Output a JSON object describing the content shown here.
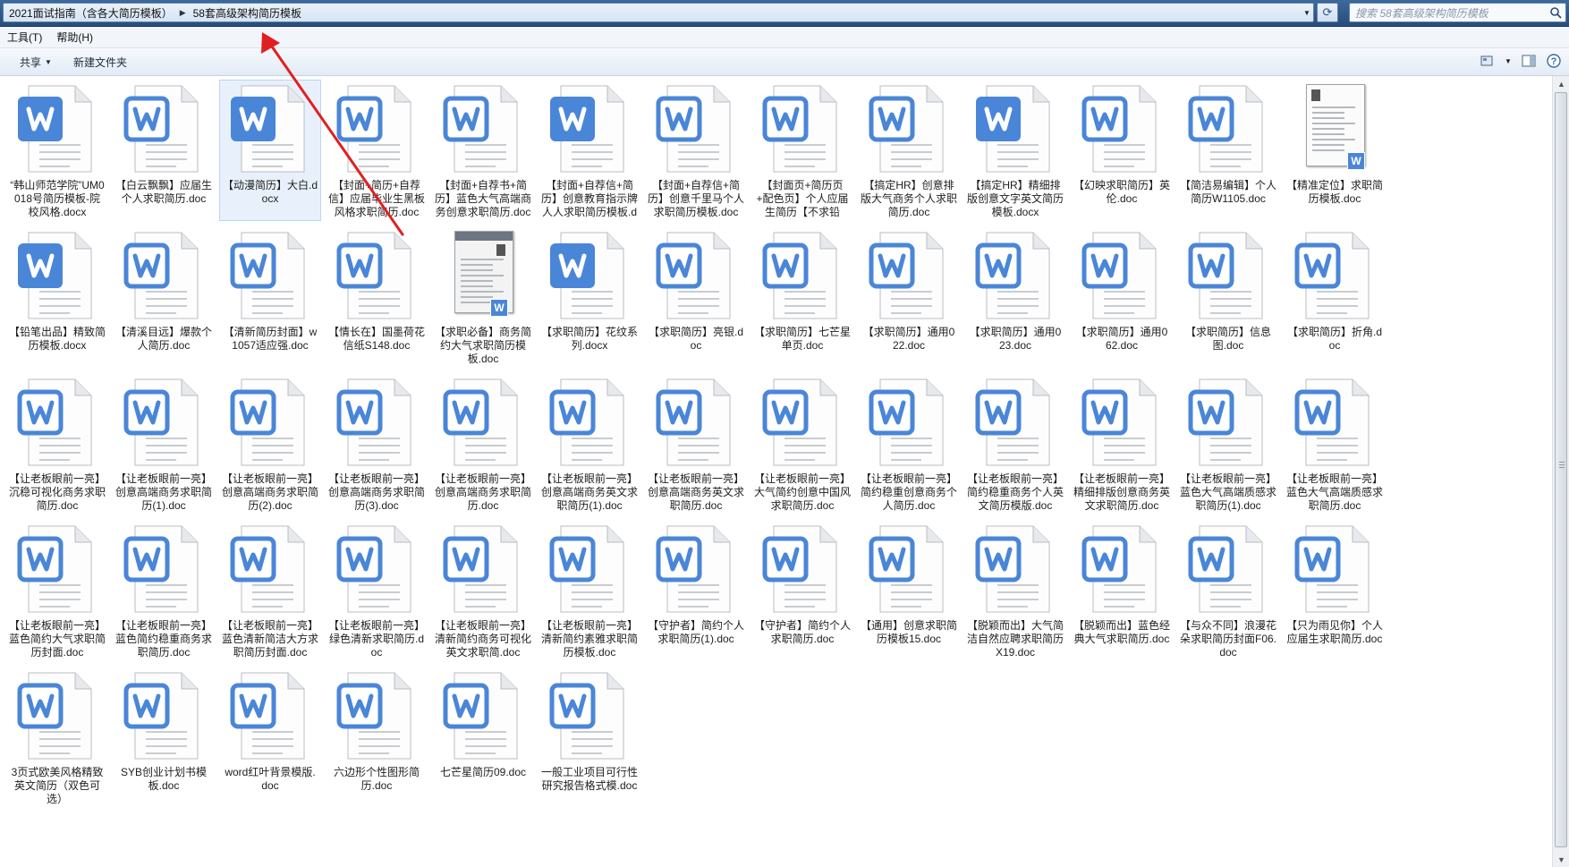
{
  "address_bar": {
    "crumbs": [
      "2021面试指南（含各大简历模板）",
      "58套高级架构简历模板"
    ],
    "search_placeholder": "搜索 58套高级架构简历模板"
  },
  "menu": {
    "items": [
      "工具(T)",
      "帮助(H)"
    ]
  },
  "command_bar": {
    "share_label": "共享",
    "new_folder_label": "新建文件夹"
  },
  "colors": {
    "word_blue": "#4a86d8",
    "annotation_arrow": "#e02020",
    "selection": "#e8f1fb"
  },
  "files": [
    {
      "name": "“韩山师范学院”UM0018号简历模板-院校风格.docx",
      "icon": "word-filled"
    },
    {
      "name": "【白云飘飘】应届生个人求职简历.doc",
      "icon": "word-outline"
    },
    {
      "name": "【动漫简历】大白.docx",
      "icon": "word-filled",
      "selected": true
    },
    {
      "name": "【封面+简历+自荐信】应届毕业生黑板风格求职简历.doc",
      "icon": "word-outline"
    },
    {
      "name": "【封面+自荐书+简历】蓝色大气高端商务创意求职简历.doc",
      "icon": "word-outline"
    },
    {
      "name": "【封面+自荐信+简历】创意教育指示牌人人求职简历模板.docx",
      "icon": "word-filled"
    },
    {
      "name": "【封面+自荐信+简历】创意千里马个人求职简历模板.doc",
      "icon": "word-outline"
    },
    {
      "name": "【封面页+简历页+配色页】个人应届生简历【不求铅华】.doc",
      "icon": "word-outline"
    },
    {
      "name": "【搞定HR】创意排版大气商务个人求职简历.doc",
      "icon": "word-outline"
    },
    {
      "name": "【搞定HR】精细排版创意文字英文简历模板.docx",
      "icon": "word-filled"
    },
    {
      "name": "【幻映求职简历】英伦.doc",
      "icon": "word-outline"
    },
    {
      "name": "【简洁易编辑】个人简历W1105.doc",
      "icon": "word-outline"
    },
    {
      "name": "【精准定位】求职简历模板.doc",
      "icon": "preview"
    },
    {
      "name": "【铅笔出品】精致简历模板.docx",
      "icon": "word-filled"
    },
    {
      "name": "【清溪目远】爆款个人简历.doc",
      "icon": "word-outline"
    },
    {
      "name": "【清新简历封面】w1057适应强.doc",
      "icon": "word-outline"
    },
    {
      "name": "【情长在】国墨荷花信纸S148.doc",
      "icon": "word-outline"
    },
    {
      "name": "【求职必备】商务简约大气求职简历模板.doc",
      "icon": "preview-dark"
    },
    {
      "name": "【求职简历】花纹系列.docx",
      "icon": "word-filled"
    },
    {
      "name": "【求职简历】亮银.doc",
      "icon": "word-outline"
    },
    {
      "name": "【求职简历】七芒星单页.doc",
      "icon": "word-outline"
    },
    {
      "name": "【求职简历】通用022.doc",
      "icon": "word-outline"
    },
    {
      "name": "【求职简历】通用023.doc",
      "icon": "word-outline"
    },
    {
      "name": "【求职简历】通用062.doc",
      "icon": "word-outline"
    },
    {
      "name": "【求职简历】信息图.doc",
      "icon": "word-outline"
    },
    {
      "name": "【求职简历】折角.doc",
      "icon": "word-outline"
    },
    {
      "name": "【让老板眼前一亮】沉稳可视化商务求职简历.doc",
      "icon": "word-outline"
    },
    {
      "name": "【让老板眼前一亮】创意高端商务求职简历(1).doc",
      "icon": "word-outline"
    },
    {
      "name": "【让老板眼前一亮】创意高端商务求职简历(2).doc",
      "icon": "word-outline"
    },
    {
      "name": "【让老板眼前一亮】创意高端商务求职简历(3).doc",
      "icon": "word-outline"
    },
    {
      "name": "【让老板眼前一亮】创意高端商务求职简历.doc",
      "icon": "word-outline"
    },
    {
      "name": "【让老板眼前一亮】创意高端商务英文求职简历(1).doc",
      "icon": "word-outline"
    },
    {
      "name": "【让老板眼前一亮】创意高端商务英文求职简历.doc",
      "icon": "word-outline"
    },
    {
      "name": "【让老板眼前一亮】大气简约创意中国风求职简历.doc",
      "icon": "word-outline"
    },
    {
      "name": "【让老板眼前一亮】简约稳重创意商务个人简历.doc",
      "icon": "word-outline"
    },
    {
      "name": "【让老板眼前一亮】简约稳重商务个人英文简历模版.doc",
      "icon": "word-outline"
    },
    {
      "name": "【让老板眼前一亮】精细排版创意商务英文求职简历.doc",
      "icon": "word-outline"
    },
    {
      "name": "【让老板眼前一亮】蓝色大气高端质感求职简历(1).doc",
      "icon": "word-outline"
    },
    {
      "name": "【让老板眼前一亮】蓝色大气高端质感求职简历.doc",
      "icon": "word-outline"
    },
    {
      "name": "【让老板眼前一亮】蓝色简约大气求职简历封面.doc",
      "icon": "word-outline"
    },
    {
      "name": "【让老板眼前一亮】蓝色简约稳重商务求职简历.doc",
      "icon": "word-outline"
    },
    {
      "name": "【让老板眼前一亮】蓝色清新简洁大方求职简历封面.doc",
      "icon": "word-outline"
    },
    {
      "name": "【让老板眼前一亮】绿色清新求职简历.doc",
      "icon": "word-outline"
    },
    {
      "name": "【让老板眼前一亮】清新简约商务可视化英文求职简.doc",
      "icon": "word-outline"
    },
    {
      "name": "【让老板眼前一亮】清新简约素雅求职简历模板.doc",
      "icon": "word-outline"
    },
    {
      "name": "【守护者】简约个人求职简历(1).doc",
      "icon": "word-outline"
    },
    {
      "name": "【守护者】简约个人求职简历.doc",
      "icon": "word-outline"
    },
    {
      "name": "【通用】创意求职简历模板15.doc",
      "icon": "word-outline"
    },
    {
      "name": "【脱颖而出】大气简洁自然应聘求职简历X19.doc",
      "icon": "word-outline"
    },
    {
      "name": "【脱颖而出】蓝色经典大气求职简历.doc",
      "icon": "word-outline"
    },
    {
      "name": "【与众不同】浪漫花朵求职简历封面F06.doc",
      "icon": "word-outline"
    },
    {
      "name": "【只为雨见你】个人应届生求职简历.doc",
      "icon": "word-outline"
    },
    {
      "name": "3页式欧美风格精致英文简历（双色可选）",
      "icon": "word-outline"
    },
    {
      "name": "SYB创业计划书模板.doc",
      "icon": "word-outline"
    },
    {
      "name": "word红叶背景模版.doc",
      "icon": "word-outline"
    },
    {
      "name": "六边形个性图形简历.doc",
      "icon": "word-outline"
    },
    {
      "name": "七芒星简历09.doc",
      "icon": "word-outline"
    },
    {
      "name": "一般工业项目可行性研究报告格式模.doc",
      "icon": "word-outline"
    }
  ]
}
